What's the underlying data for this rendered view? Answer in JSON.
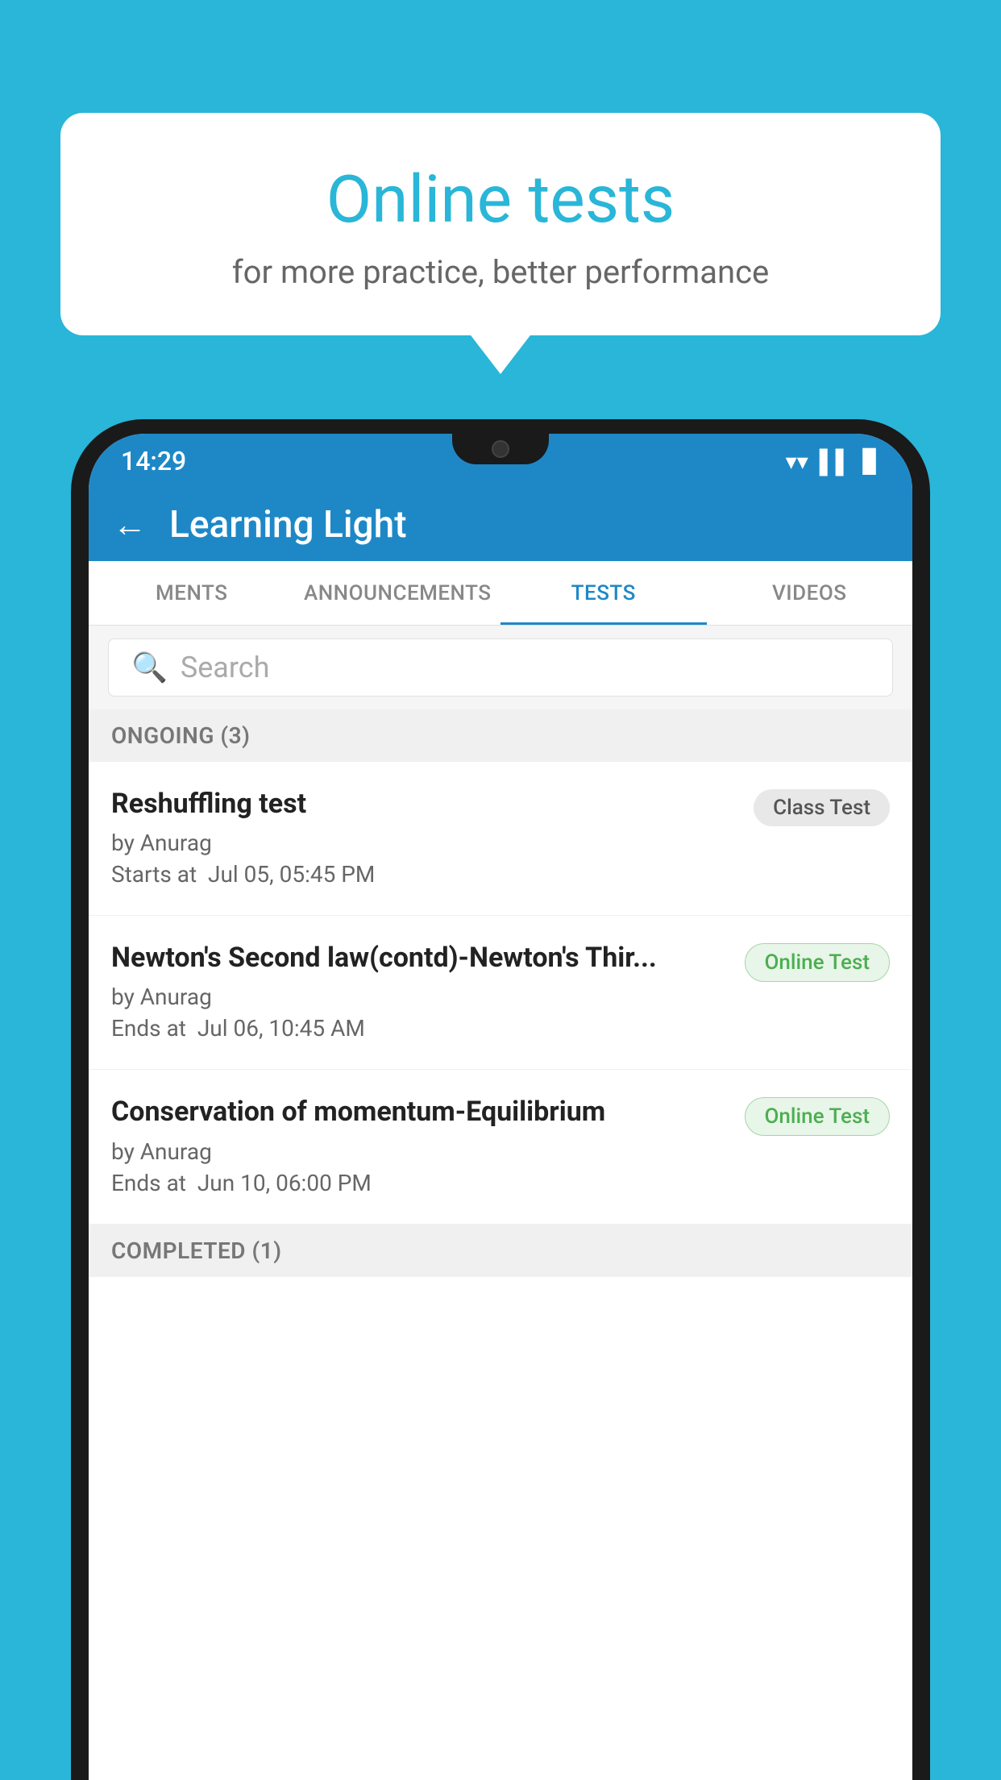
{
  "background": {
    "color": "#29b6d8"
  },
  "speech_bubble": {
    "title": "Online tests",
    "subtitle": "for more practice, better performance"
  },
  "status_bar": {
    "time": "14:29",
    "wifi_icon": "▼",
    "signal_icon": "▲",
    "battery_icon": "▊"
  },
  "app_header": {
    "back_label": "←",
    "title": "Learning Light"
  },
  "tabs": [
    {
      "label": "MENTS",
      "active": false
    },
    {
      "label": "ANNOUNCEMENTS",
      "active": false
    },
    {
      "label": "TESTS",
      "active": true
    },
    {
      "label": "VIDEOS",
      "active": false
    }
  ],
  "search": {
    "placeholder": "Search",
    "icon": "🔍"
  },
  "ongoing_section": {
    "label": "ONGOING (3)"
  },
  "test_items": [
    {
      "name": "Reshuffling test",
      "by": "by Anurag",
      "time_label": "Starts at",
      "time": "Jul 05, 05:45 PM",
      "badge": "Class Test",
      "badge_type": "class"
    },
    {
      "name": "Newton's Second law(contd)-Newton's Thir...",
      "by": "by Anurag",
      "time_label": "Ends at",
      "time": "Jul 06, 10:45 AM",
      "badge": "Online Test",
      "badge_type": "online"
    },
    {
      "name": "Conservation of momentum-Equilibrium",
      "by": "by Anurag",
      "time_label": "Ends at",
      "time": "Jun 10, 06:00 PM",
      "badge": "Online Test",
      "badge_type": "online"
    }
  ],
  "completed_section": {
    "label": "COMPLETED (1)"
  }
}
